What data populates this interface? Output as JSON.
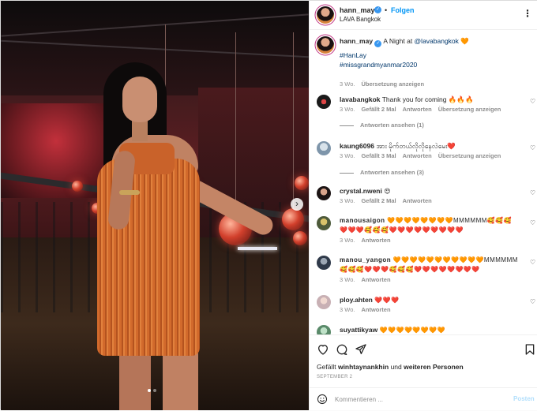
{
  "header": {
    "username": "hann_may",
    "dot": "•",
    "follow_label": "Folgen",
    "location": "LAVA Bangkok",
    "more_label": "⋮"
  },
  "caption": {
    "username": "hann_may",
    "text_prefix": "A Night at ",
    "mention": "@lavabangkok",
    "emoji": "🧡",
    "hashtag1": "#HanLay",
    "hashtag2": "#missgrandmyanmar2020",
    "age": "3 Wo.",
    "translate": "Übersetzung anzeigen"
  },
  "comments": [
    {
      "username": "lavabangkok",
      "text": "Thank you for coming 🔥🔥🔥",
      "age": "3 Wo.",
      "likes": "Gefällt 2 Mal",
      "reply": "Antworten",
      "translate": "Übersetzung anzeigen",
      "replies": "Antworten ansehen (1)"
    },
    {
      "username": "kaung6096",
      "text": "အား မိုက်တယ်လိုလိုနေလဲမေး❤️",
      "age": "3 Wo.",
      "likes": "Gefällt 3 Mal",
      "reply": "Antworten",
      "translate": "Übersetzung anzeigen",
      "replies": "Antworten ansehen (3)"
    },
    {
      "username": "crystal.nweni",
      "text": "😍",
      "age": "3 Wo.",
      "likes": "Gefällt 2 Mal",
      "reply": "Antworten"
    },
    {
      "username": "manousaigon",
      "text": "🧡🧡🧡🧡🧡🧡🧡🧡MMMMMM🥰🥰🥰❤️❤️❤️🥰🥰🥰❤️❤️❤️❤️❤️❤️❤️❤️❤️",
      "age": "3 Wo.",
      "reply": "Antworten"
    },
    {
      "username": "manou_yangon",
      "text": "🧡🧡🧡🧡🧡🧡🧡🧡🧡🧡🧡MMMMMM🥰🥰🥰❤️❤️❤️🥰🥰🥰❤️❤️❤️❤️❤️❤️❤️❤️",
      "age": "3 Wo.",
      "reply": "Antworten"
    },
    {
      "username": "ploy.ahten",
      "text": "❤️❤️❤️",
      "age": "3 Wo.",
      "reply": "Antworten"
    },
    {
      "username": "suyattikyaw",
      "text": "🧡🧡🧡🧡🧡🧡🧡🧡",
      "age": "",
      "reply": ""
    }
  ],
  "actions": {
    "liked_by_prefix": "Gefällt",
    "liked_by_user": "winhtaynankhin",
    "liked_by_mid": "und",
    "liked_by_rest": "weiteren Personen",
    "date": "SEPTEMBER 2"
  },
  "comment_box": {
    "placeholder": "Kommentieren ...",
    "post_label": "Posten"
  },
  "carousel": {
    "next_label": "›",
    "slide_count": 2,
    "active_slide": 1
  },
  "colors": {
    "accent": "#0095f6",
    "verified": "#3897f0",
    "muted": "#8e8e8e"
  }
}
